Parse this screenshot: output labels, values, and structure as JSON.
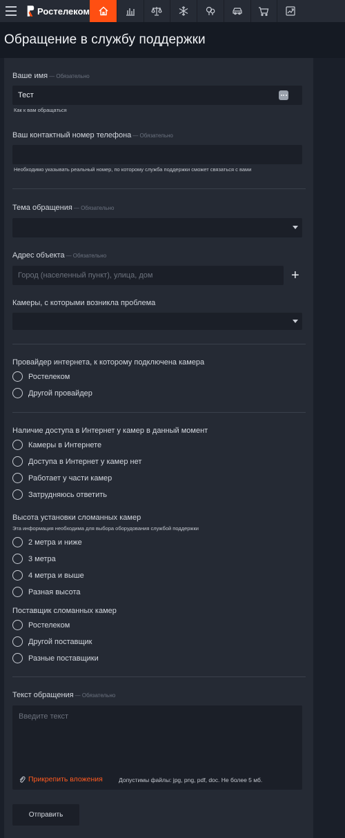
{
  "header": {
    "brand": "Ростелеком",
    "nav_icons": [
      "home-icon",
      "bar-chart-icon",
      "scales-icon",
      "snowflake-icon",
      "trees-icon",
      "car-icon",
      "cart-icon",
      "trending-up-icon"
    ],
    "accent_color": "#ff4f12"
  },
  "page": {
    "title": "Обращение в службу поддержки"
  },
  "form": {
    "required_note": "— Обязательно",
    "name": {
      "label": "Ваше имя",
      "value": "Тест",
      "hint": "Как к вам обращаться"
    },
    "phone": {
      "label": "Ваш контактный номер телефона",
      "value": "",
      "hint": "Необходимо указывать реальный номер, по которому служба поддержки сможет связаться с вами"
    },
    "topic": {
      "label": "Тема обращения",
      "value": ""
    },
    "address": {
      "label": "Адрес объекта",
      "placeholder": "Город (населенный пункт), улица, дом"
    },
    "cameras": {
      "label": "Камеры, с которыми возникла проблема",
      "value": ""
    },
    "provider": {
      "label": "Провайдер интернета, к которому подключена камера",
      "options": [
        "Ростелеком",
        "Другой провайдер"
      ]
    },
    "internet_access": {
      "label": "Наличие доступа в Интернет у камер в данный момент",
      "options": [
        "Камеры в Интернете",
        "Доступа в Интернет у камер нет",
        "Работает у части камер",
        "Затрудняюсь ответить"
      ]
    },
    "height": {
      "label": "Высота установки сломанных камер",
      "hint": "Эта информация необходима для выбора оборудования службой поддержки",
      "options": [
        "2 метра и ниже",
        "3 метра",
        "4 метра и выше",
        "Разная высота"
      ]
    },
    "vendor": {
      "label": "Поставщик сломанных камер",
      "options": [
        "Ростелеком",
        "Другой поставщик",
        "Разные поставщики"
      ]
    },
    "message": {
      "label": "Текст обращения",
      "placeholder": "Введите текст"
    },
    "attach": {
      "label": "Прикрепить вложения",
      "allowed": "Допустимы файлы: jpg, png, pdf, doc. Не более 5 мб."
    },
    "submit_label": "Отправить"
  }
}
